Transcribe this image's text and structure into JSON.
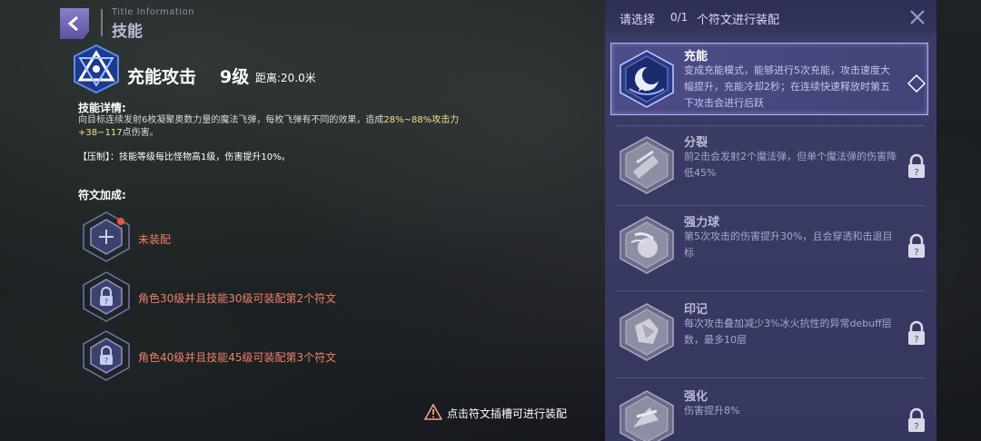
{
  "header": {
    "subtitle": "Title Information",
    "title": "技能"
  },
  "skill": {
    "name": "充能攻击",
    "level": "9级",
    "range": "距离:20.0米",
    "detail_title": "技能详情:",
    "detail_line1_a": "向目标连续发射6枚凝聚奥数力量的魔法飞弹，每枚飞弹有不同的效果，造成",
    "detail_line1_hl": "28%~88%攻击力",
    "detail_line2_hl": "+38~117",
    "detail_line2_b": "点伤害。",
    "suppress": "【压制】：技能等级每比怪物高1级，伤害提升10%。"
  },
  "runes_section": {
    "title": "符文加成:",
    "slots": [
      {
        "label": "未装配",
        "state": "empty",
        "icon": "plus-icon"
      },
      {
        "label": "角色30级并且技能30级可装配第2个符文",
        "state": "locked",
        "icon": "lock-icon"
      },
      {
        "label": "角色40级并且技能45级可装配第3个符文",
        "state": "locked",
        "icon": "lock-icon"
      }
    ]
  },
  "hint": "点击符文插槽可进行装配",
  "panel": {
    "prefix": "请选择",
    "count": "0/1",
    "suffix": "个符文进行装配",
    "items": [
      {
        "name": "充能",
        "desc": "变成充能模式，能够进行5次充能，攻击速度大幅提升，充能冷却2秒；在连续快速释放时第五下攻击会进行后跃",
        "locked": false,
        "selected": true
      },
      {
        "name": "分裂",
        "desc": "前2击会发射2个魔法弹，但单个魔法弹的伤害降低45%",
        "locked": true,
        "selected": false
      },
      {
        "name": "强力球",
        "desc": "第5次攻击的伤害提升30%，且会穿透和击退目标",
        "locked": true,
        "selected": false
      },
      {
        "name": "印记",
        "desc": "每次攻击叠加减少3%冰火抗性的异常debuff层数，最多10层",
        "locked": true,
        "selected": false
      },
      {
        "name": "强化",
        "desc": "伤害提升8%",
        "locked": true,
        "selected": false
      }
    ]
  },
  "colors": {
    "accent": "#f08068",
    "highlight": "#f0e08a",
    "panel": "#3b3d68"
  }
}
